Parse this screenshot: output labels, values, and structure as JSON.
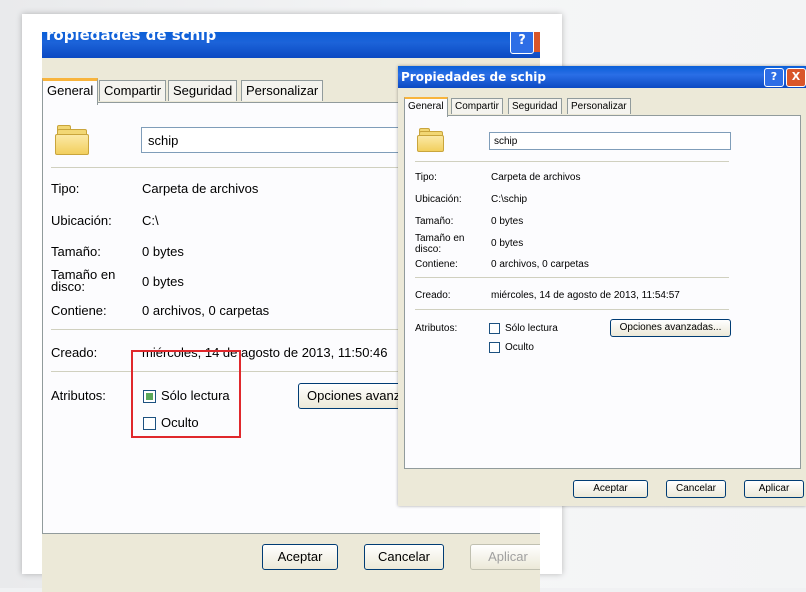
{
  "left": {
    "title": "ropiedades de schip",
    "help_glyph": "?",
    "tabs": [
      "General",
      "Compartir",
      "Seguridad",
      "Personalizar"
    ],
    "name": "schip",
    "rows": [
      {
        "label": "Tipo:",
        "value": "Carpeta de archivos"
      },
      {
        "label": "Ubicación:",
        "value": "C:\\"
      },
      {
        "label": "Tamaño:",
        "value": "0 bytes"
      },
      {
        "label": "Tamaño en disco:",
        "value": "0 bytes"
      },
      {
        "label": "Contiene:",
        "value": "0 archivos, 0 carpetas"
      }
    ],
    "created_label": "Creado:",
    "created_value": "miércoles, 14 de agosto de 2013, 11:50:46",
    "attributes_label": "Atributos:",
    "readonly_label": "Sólo lectura",
    "hidden_label": "Oculto",
    "advanced_button": "Opciones avanz",
    "ok_button": "Aceptar",
    "cancel_button": "Cancelar",
    "apply_button": "Aplicar"
  },
  "right": {
    "title": "Propiedades de schip",
    "help_glyph": "?",
    "close_glyph": "X",
    "tabs": [
      "General",
      "Compartir",
      "Seguridad",
      "Personalizar"
    ],
    "name": "schip",
    "rows": [
      {
        "label": "Tipo:",
        "value": "Carpeta de archivos"
      },
      {
        "label": "Ubicación:",
        "value": "C:\\schip"
      },
      {
        "label": "Tamaño:",
        "value": "0 bytes"
      },
      {
        "label": "Tamaño en disco:",
        "value": "0 bytes"
      },
      {
        "label": "Contiene:",
        "value": "0 archivos, 0 carpetas"
      }
    ],
    "created_label": "Creado:",
    "created_value": "miércoles, 14 de agosto de 2013, 11:54:57",
    "attributes_label": "Atributos:",
    "readonly_label": "Sólo lectura",
    "hidden_label": "Oculto",
    "advanced_button": "Opciones avanzadas...",
    "ok_button": "Aceptar",
    "cancel_button": "Cancelar",
    "apply_button": "Aplicar"
  },
  "colors": {
    "titlebar": "#0b54d4",
    "highlight_box": "#e0282c",
    "dialog_bg": "#ece9d8",
    "tab_accent": "#f8b43c"
  }
}
